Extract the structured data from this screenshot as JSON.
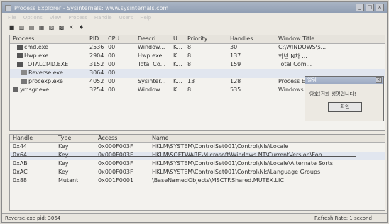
{
  "window": {
    "title": "Process Explorer - Sysinternals: www.sysinternals.com"
  },
  "menu": [
    "File",
    "Options",
    "View",
    "Process",
    "Handle",
    "Users",
    "Help"
  ],
  "process_columns": [
    "Process",
    "PID",
    "CPU",
    "Descri...",
    "U...",
    "Priority",
    "Handles",
    "Window Title"
  ],
  "processes": [
    {
      "name": "cmd.exe",
      "pid": "2536",
      "cpu": "00",
      "desc": "Window...",
      "user": "K...",
      "priority": "8",
      "handles": "30",
      "title": "C:\\WINDOWS\\s..."
    },
    {
      "name": "Hwp.exe",
      "pid": "2904",
      "cpu": "00",
      "desc": "Hwp.exe",
      "user": "K...",
      "priority": "8",
      "handles": "137",
      "title": "학년 N차 ..."
    },
    {
      "name": "TOTALCMD.EXE",
      "pid": "3152",
      "cpu": "00",
      "desc": "Total Co...",
      "user": "K...",
      "priority": "8",
      "handles": "159",
      "title": "Total Com..."
    },
    {
      "name": "Reverse.exe",
      "pid": "3064",
      "cpu": "00",
      "desc": "",
      "user": "",
      "priority": "",
      "handles": "",
      "title": ""
    },
    {
      "name": "procexp.exe",
      "pid": "4052",
      "cpu": "00",
      "desc": "Sysinter...",
      "user": "K...",
      "priority": "13",
      "handles": "128",
      "title": "Process E..."
    },
    {
      "name": "ymsgr.exe",
      "pid": "3254",
      "cpu": "00",
      "desc": "Window...",
      "user": "K...",
      "priority": "8",
      "handles": "535",
      "title": "Windows ..."
    }
  ],
  "handle_columns": [
    "Handle",
    "Type",
    "Access",
    "Name"
  ],
  "handles": [
    {
      "handle": "0x44",
      "type": "Key",
      "access": "0x000F003F",
      "name": "HKLM\\SYSTEM\\ControlSet001\\Control\\Nls\\Locale"
    },
    {
      "handle": "0x64",
      "type": "Key",
      "access": "0x000F003F",
      "name": "HKLM\\SOFTWARE\\Microsoft\\Windows NT\\CurrentVersion\\Fon..."
    },
    {
      "handle": "0xAB",
      "type": "Key",
      "access": "0x000F003F",
      "name": "HKLM\\SYSTEM\\ControlSet001\\Control\\Nls\\Locale\\Alternate Sorts"
    },
    {
      "handle": "0xAC",
      "type": "Key",
      "access": "0x000F003F",
      "name": "HKLM\\SYSTEM\\ControlSet001\\Control\\Nls\\Language Groups"
    },
    {
      "handle": "0x88",
      "type": "Mutant",
      "access": "0x001F0001",
      "name": "\\BaseNamedObjects\\MSCTF.Shared.MUTEX.LIC"
    }
  ],
  "dialog": {
    "title": "알림",
    "message": "암호(전화 성명입니다!",
    "ok": "확인"
  },
  "status": {
    "left": "Reverse.exe pid: 3064",
    "right": "Refresh Rate: 1 second"
  }
}
